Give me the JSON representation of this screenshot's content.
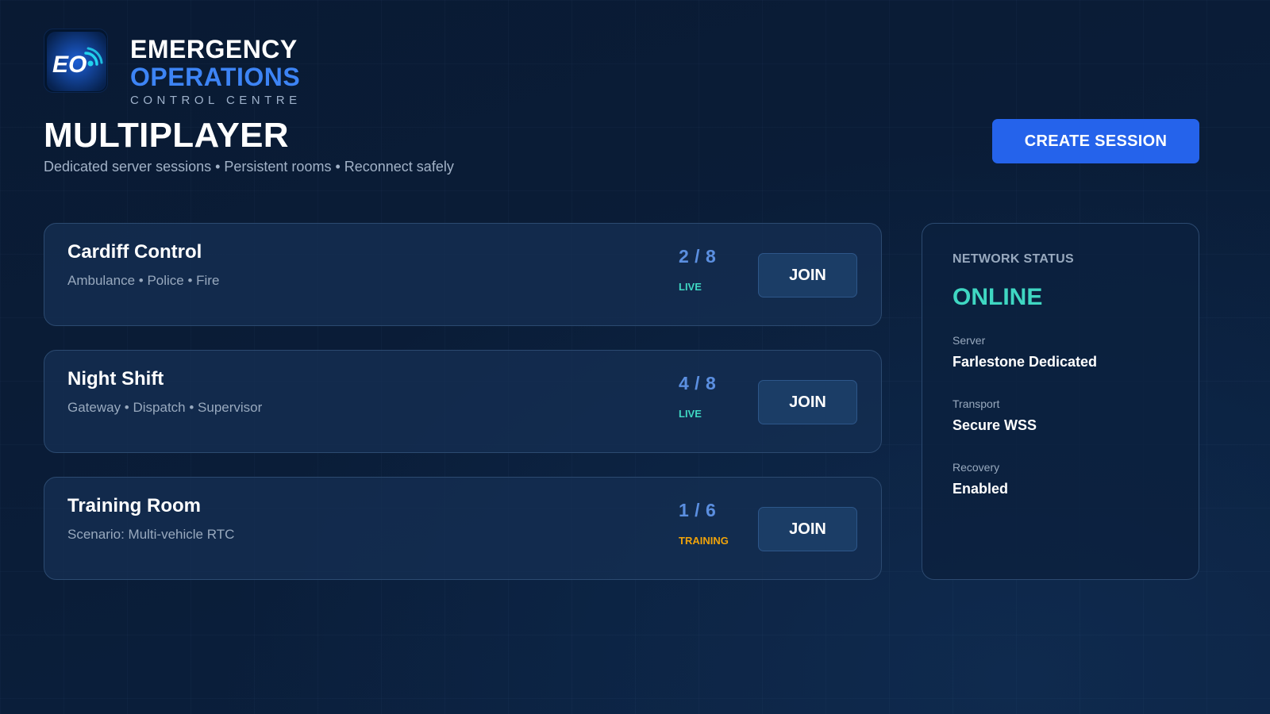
{
  "brand": {
    "line1": "EMERGENCY",
    "line2": "OPERATIONS",
    "line3": "CONTROL CENTRE",
    "logo_text": "EO"
  },
  "header": {
    "title": "MULTIPLAYER",
    "subtitle": "Dedicated server sessions • Persistent rooms • Reconnect safely",
    "create_button": "CREATE SESSION"
  },
  "sessions": [
    {
      "name": "Cardiff Control",
      "detail": "Ambulance • Police • Fire",
      "players": "2 / 8",
      "status": "LIVE",
      "status_color": "#3fd7c2",
      "join_label": "JOIN"
    },
    {
      "name": "Night Shift",
      "detail": "Gateway • Dispatch • Supervisor",
      "players": "4 / 8",
      "status": "LIVE",
      "status_color": "#3fd7c2",
      "join_label": "JOIN"
    },
    {
      "name": "Training Room",
      "detail": "Scenario: Multi-vehicle RTC",
      "players": "1 / 6",
      "status": "TRAINING",
      "status_color": "#f0a30a",
      "join_label": "JOIN"
    }
  ],
  "network": {
    "title": "NETWORK STATUS",
    "state": "ONLINE",
    "fields": [
      {
        "label": "Server",
        "value": "Farlestone Dedicated"
      },
      {
        "label": "Transport",
        "value": "Secure WSS"
      },
      {
        "label": "Recovery",
        "value": "Enabled"
      }
    ]
  },
  "colors": {
    "accent": "#2563eb",
    "brand_blue": "#3d84f5",
    "online": "#3fd7c2",
    "training": "#f0a30a"
  }
}
